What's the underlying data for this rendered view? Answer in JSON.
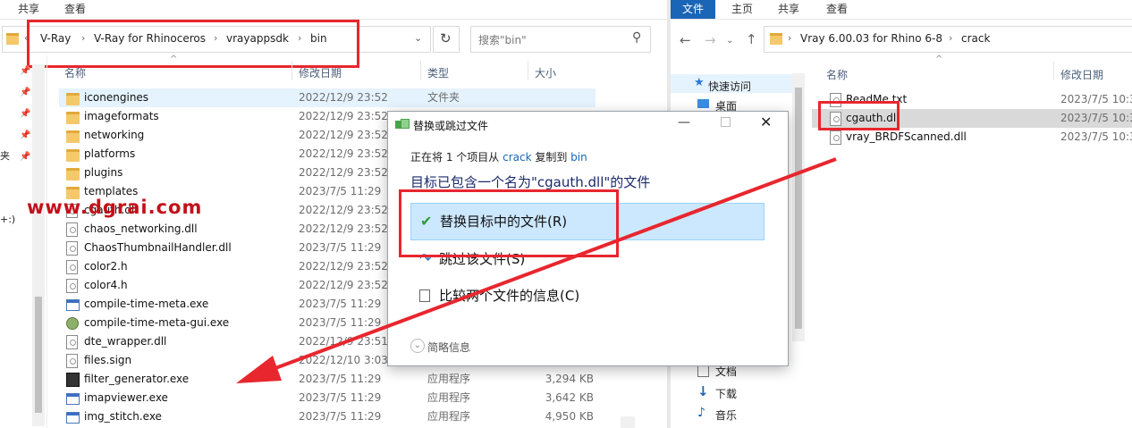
{
  "left_window": {
    "ribbon_tabs": [
      "共享",
      "查看"
    ],
    "breadcrumb": [
      "V-Ray",
      "V-Ray for Rhinoceros",
      "vrayappsdk",
      "bin"
    ],
    "search_placeholder": "搜索\"bin\"",
    "columns": [
      "名称",
      "修改日期",
      "类型",
      "大小"
    ],
    "side_labels": [
      "夹",
      "+:)"
    ],
    "rows": [
      {
        "name": "iconengines",
        "date": "2022/12/9 23:52",
        "type": "文件夹",
        "size": "",
        "icon": "folder"
      },
      {
        "name": "imageformats",
        "date": "2022/12/9 23:52",
        "type": "",
        "size": "",
        "icon": "folder"
      },
      {
        "name": "networking",
        "date": "2022/12/9 23:52",
        "type": "",
        "size": "",
        "icon": "folder"
      },
      {
        "name": "platforms",
        "date": "2022/12/9 23:52",
        "type": "",
        "size": "",
        "icon": "folder"
      },
      {
        "name": "plugins",
        "date": "2022/12/9 23:52",
        "type": "",
        "size": "",
        "icon": "folder"
      },
      {
        "name": "templates",
        "date": "2023/7/5 11:29",
        "type": "",
        "size": "",
        "icon": "folder"
      },
      {
        "name": "cgauth.dll",
        "date": "2022/12/9 23:52",
        "type": "",
        "size": "",
        "icon": "file"
      },
      {
        "name": "chaos_networking.dll",
        "date": "2022/12/9 23:52",
        "type": "",
        "size": "",
        "icon": "file"
      },
      {
        "name": "ChaosThumbnailHandler.dll",
        "date": "2023/7/5 11:29",
        "type": "",
        "size": "",
        "icon": "file"
      },
      {
        "name": "color2.h",
        "date": "2022/12/9 23:52",
        "type": "",
        "size": "",
        "icon": "file"
      },
      {
        "name": "color4.h",
        "date": "2022/12/9 23:52",
        "type": "",
        "size": "",
        "icon": "file"
      },
      {
        "name": "compile-time-meta.exe",
        "date": "2023/7/5 11:29",
        "type": "",
        "size": "",
        "icon": "exe"
      },
      {
        "name": "compile-time-meta-gui.exe",
        "date": "2023/7/5 11:29",
        "type": "",
        "size": "",
        "icon": "gear"
      },
      {
        "name": "dte_wrapper.dll",
        "date": "2022/12/9 23:51",
        "type": "",
        "size": "",
        "icon": "file"
      },
      {
        "name": "files.sign",
        "date": "2022/12/10 3:03",
        "type": "",
        "size": "",
        "icon": "file"
      },
      {
        "name": "filter_generator.exe",
        "date": "2023/7/5 11:29",
        "type": "应用程序",
        "size": "3,294 KB",
        "icon": "dark"
      },
      {
        "name": "imapviewer.exe",
        "date": "2023/7/5 11:29",
        "type": "应用程序",
        "size": "3,642 KB",
        "icon": "exe"
      },
      {
        "name": "img_stitch.exe",
        "date": "2023/7/5 11:29",
        "type": "应用程序",
        "size": "4,950 KB",
        "icon": "exe"
      }
    ]
  },
  "right_window": {
    "ribbon_tabs": [
      "文件",
      "主页",
      "共享",
      "查看"
    ],
    "breadcrumb": [
      "Vray 6.00.03 for Rhino 6-8",
      "crack"
    ],
    "columns": [
      "名称",
      "修改日期"
    ],
    "sidebar": [
      "快速访问",
      "桌面",
      "文档",
      "下载",
      "音乐"
    ],
    "rows": [
      {
        "name": "ReadMe.txt",
        "date": "2023/7/5 10:3",
        "icon": "file"
      },
      {
        "name": "cgauth.dll",
        "date": "2023/7/5 10:3",
        "icon": "file"
      },
      {
        "name": "vray_BRDFScanned.dll",
        "date": "2023/7/5 10:3",
        "icon": "file"
      }
    ]
  },
  "dialog": {
    "title": "替换或跳过文件",
    "progress": {
      "pre": "正在将 1 个项目从 ",
      "src": "crack",
      "mid": " 复制到 ",
      "dst": "bin"
    },
    "heading": "目标已包含一个名为\"cgauth.dll\"的文件",
    "options": [
      {
        "label": "替换目标中的文件(R)",
        "icon": "check-icon"
      },
      {
        "label": "跳过该文件(S)",
        "icon": "skip-arrow-icon"
      },
      {
        "label": "比较两个文件的信息(C)",
        "icon": "compare-icon"
      }
    ],
    "details": "简略信息"
  },
  "watermark": "www.dgrai.com",
  "colors": {
    "annotation_red": "#e8262e",
    "selection_blue": "#cce8ff",
    "link_blue": "#1a65b5"
  }
}
